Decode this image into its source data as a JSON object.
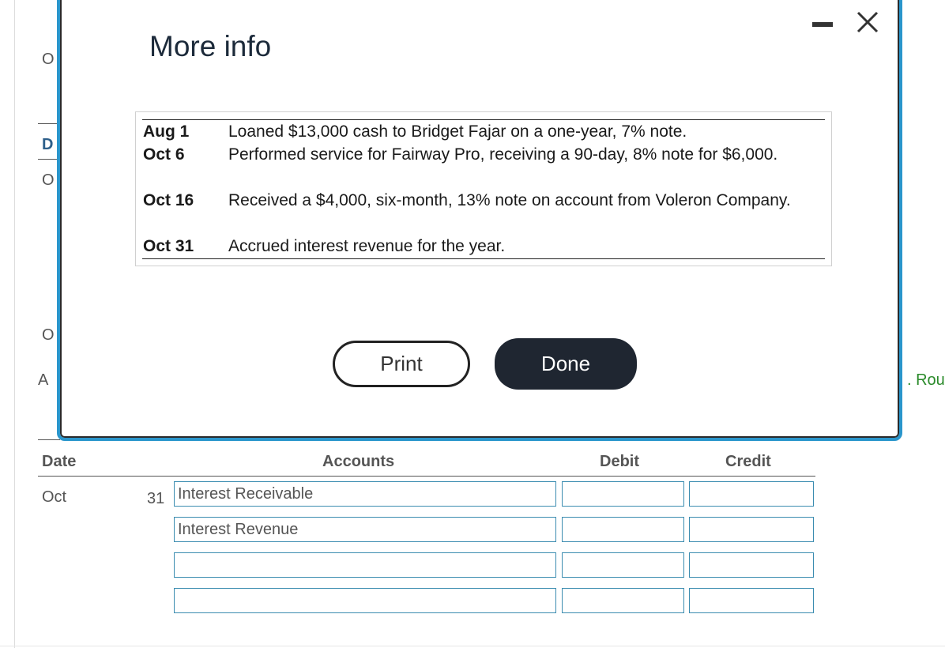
{
  "background": {
    "fragments": [
      "O",
      "D",
      "O",
      "O",
      "A",
      ". Rou"
    ],
    "journal": {
      "headers": {
        "date": "Date",
        "accounts": "Accounts",
        "debit": "Debit",
        "credit": "Credit"
      },
      "rows": [
        {
          "month": "Oct",
          "day": "31",
          "account": "Interest Receivable",
          "debit": "",
          "credit": ""
        },
        {
          "month": "",
          "day": "",
          "account": "Interest Revenue",
          "debit": "",
          "credit": ""
        },
        {
          "month": "",
          "day": "",
          "account": "",
          "debit": "",
          "credit": ""
        },
        {
          "month": "",
          "day": "",
          "account": "",
          "debit": "",
          "credit": ""
        }
      ]
    }
  },
  "modal": {
    "title": "More info",
    "events": [
      {
        "date": "Aug 1",
        "text": "Loaned $13,000 cash to Bridget Fajar on a one-year, 7% note."
      },
      {
        "date": "Oct 6",
        "text": "Performed service for Fairway Pro, receiving a 90-day, 8% note for $6,000."
      },
      {
        "date": "Oct 16",
        "text": "Received a $4,000, six-month, 13% note on account from Voleron Company."
      },
      {
        "date": "Oct 31",
        "text": "Accrued interest revenue for the year."
      }
    ],
    "buttons": {
      "print": "Print",
      "done": "Done"
    },
    "icons": {
      "minimize": "minimize-icon",
      "close": "close-icon"
    }
  },
  "colors": {
    "modal_border": "#2a96cc",
    "done_button": "#1f2631",
    "input_border": "#3b8cb0",
    "link_green": "#2a8a2a"
  }
}
